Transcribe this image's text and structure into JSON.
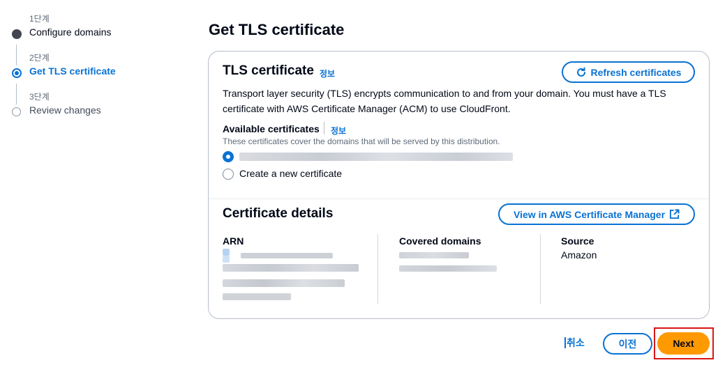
{
  "steps": [
    {
      "num": "1단계",
      "name": "Configure domains",
      "state": "done"
    },
    {
      "num": "2단계",
      "name": "Get TLS certificate",
      "state": "current"
    },
    {
      "num": "3단계",
      "name": "Review changes",
      "state": "pending"
    }
  ],
  "page_title": "Get TLS certificate",
  "tls": {
    "title": "TLS certificate",
    "info": "정보",
    "refresh_label": "Refresh certificates",
    "refresh_icon": "refresh-icon",
    "description": "Transport layer security (TLS) encrypts communication to and from your domain. You must have a TLS certificate with AWS Certificate Manager (ACM) to use CloudFront.",
    "available_label": "Available certificates",
    "available_info": "정보",
    "available_desc": "These certificates cover the domains that will be served by this distribution.",
    "option_new": "Create a new certificate",
    "selected_option": "existing"
  },
  "details": {
    "title": "Certificate details",
    "view_label": "View in AWS Certificate Manager",
    "view_icon": "external-link-icon",
    "arn_label": "ARN",
    "covered_label": "Covered domains",
    "source_label": "Source",
    "source_value": "Amazon"
  },
  "footer": {
    "cancel_label": "취소",
    "prev_label": "이전",
    "next_label": "Next"
  },
  "colors": {
    "accent": "#0972d3",
    "primary_button": "#ff9900",
    "highlight": "#d91515"
  }
}
